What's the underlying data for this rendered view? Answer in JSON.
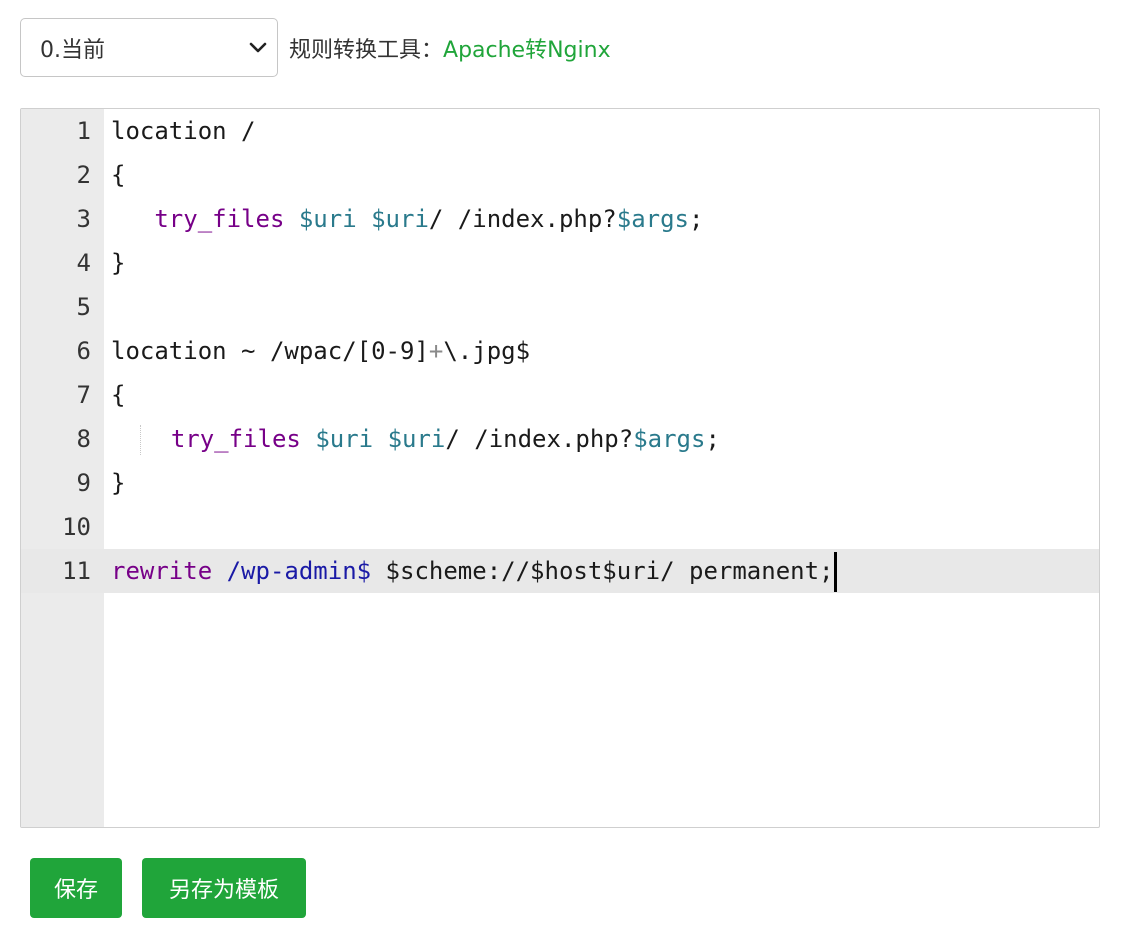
{
  "toolbar": {
    "version_select": "0.当前",
    "tool_label": "规则转换工具：",
    "tool_link": "Apache转Nginx"
  },
  "editor": {
    "line_numbers": [
      "1",
      "2",
      "3",
      "4",
      "5",
      "6",
      "7",
      "8",
      "9",
      "10",
      "11"
    ],
    "active_line": 11,
    "lines": [
      {
        "tokens": [
          {
            "t": "location /",
            "c": ""
          }
        ]
      },
      {
        "tokens": [
          {
            "t": "{",
            "c": ""
          }
        ]
      },
      {
        "tokens": [
          {
            "t": "   ",
            "c": ""
          },
          {
            "t": "try_files",
            "c": "kw"
          },
          {
            "t": " ",
            "c": ""
          },
          {
            "t": "$uri",
            "c": "var"
          },
          {
            "t": " ",
            "c": ""
          },
          {
            "t": "$uri",
            "c": "var"
          },
          {
            "t": "/ /index.php?",
            "c": ""
          },
          {
            "t": "$args",
            "c": "var"
          },
          {
            "t": ";",
            "c": ""
          }
        ]
      },
      {
        "tokens": [
          {
            "t": "}",
            "c": ""
          }
        ]
      },
      {
        "tokens": []
      },
      {
        "tokens": [
          {
            "t": "location ~ /wpac/[0-9]",
            "c": ""
          },
          {
            "t": "+",
            "c": "op"
          },
          {
            "t": "\\.jpg$",
            "c": ""
          }
        ]
      },
      {
        "tokens": [
          {
            "t": "{",
            "c": ""
          }
        ]
      },
      {
        "tokens": [
          {
            "t": "  ",
            "c": ""
          },
          {
            "t": "|",
            "c": "guide"
          },
          {
            "t": "  ",
            "c": ""
          },
          {
            "t": "try_files",
            "c": "kw"
          },
          {
            "t": " ",
            "c": ""
          },
          {
            "t": "$uri",
            "c": "var"
          },
          {
            "t": " ",
            "c": ""
          },
          {
            "t": "$uri",
            "c": "var"
          },
          {
            "t": "/ /index.php?",
            "c": ""
          },
          {
            "t": "$args",
            "c": "var"
          },
          {
            "t": ";",
            "c": ""
          }
        ]
      },
      {
        "tokens": [
          {
            "t": "}",
            "c": ""
          }
        ]
      },
      {
        "tokens": []
      },
      {
        "tokens": [
          {
            "t": "rewrite",
            "c": "kw"
          },
          {
            "t": " ",
            "c": ""
          },
          {
            "t": "/wp-admin$",
            "c": "str"
          },
          {
            "t": " $scheme://$host$uri/ permanent;",
            "c": ""
          },
          {
            "t": "",
            "c": "cursor"
          }
        ]
      }
    ]
  },
  "buttons": {
    "save": "保存",
    "save_as_template": "另存为模板"
  },
  "colors": {
    "accent": "#20a53a",
    "keyword": "#770088",
    "variable": "#2a7a8c",
    "string": "#1a1aa6"
  }
}
